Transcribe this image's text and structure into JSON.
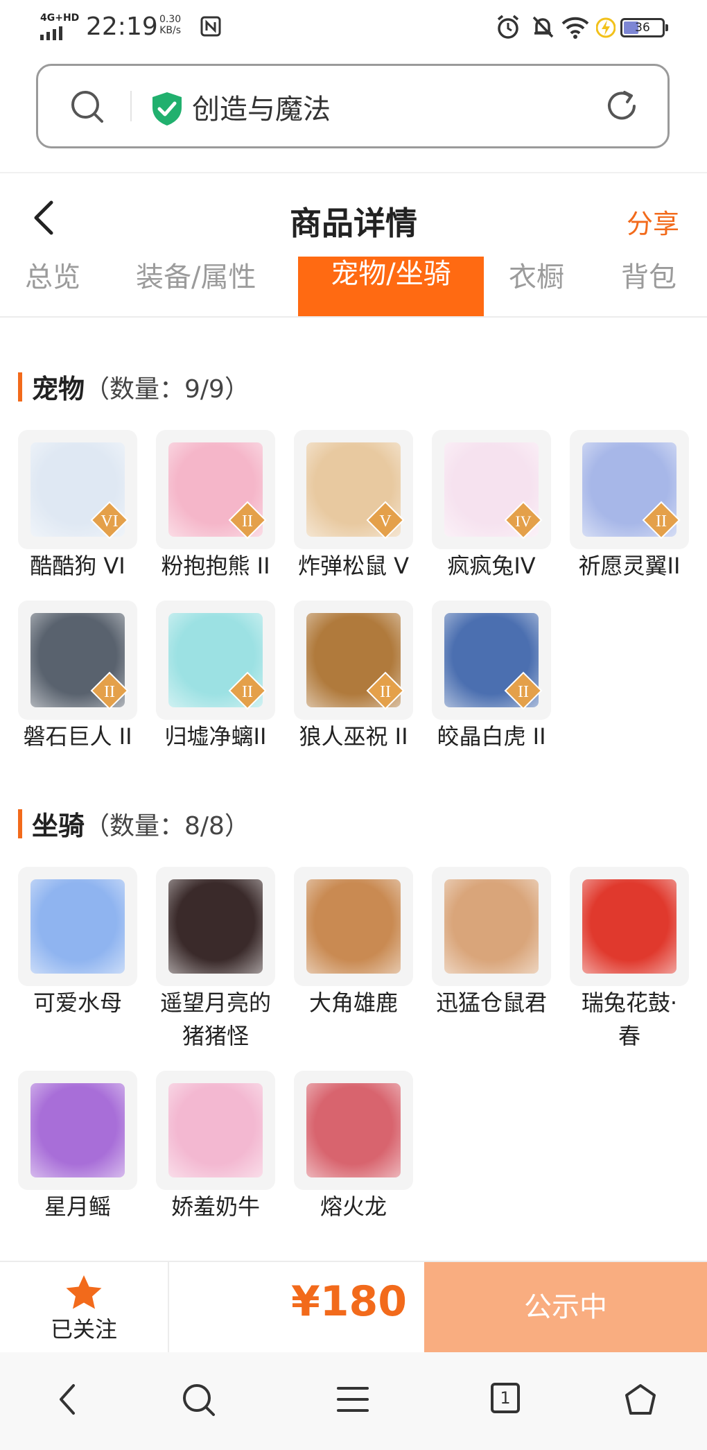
{
  "status_bar": {
    "network": "4G+HD",
    "time": "22:19",
    "speed_value": "0.30",
    "speed_unit": "KB/s",
    "battery": "36",
    "icons": [
      "signal-icon",
      "nfc-icon",
      "alarm-icon",
      "mute-icon",
      "wifi-icon",
      "charging-icon",
      "battery-icon"
    ]
  },
  "address_bar": {
    "site_title": "创造与魔法",
    "icons": [
      "search-icon",
      "verified-shield-icon",
      "reload-icon"
    ]
  },
  "header": {
    "title": "商品详情",
    "share_label": "分享"
  },
  "tabs": [
    {
      "label": "总览",
      "active": false
    },
    {
      "label": "装备/属性",
      "active": false
    },
    {
      "label": "宠物/坐骑",
      "active": true
    },
    {
      "label": "衣橱",
      "active": false
    },
    {
      "label": "背包",
      "active": false
    }
  ],
  "pets": {
    "title": "宠物",
    "count": "（数量：9/9）",
    "items": [
      {
        "name": "酷酷狗 VI",
        "tier": "VI",
        "color": "#dfe8f3"
      },
      {
        "name": "粉抱抱熊 II",
        "tier": "II",
        "color": "#f5b6c9"
      },
      {
        "name": "炸弹松鼠 V",
        "tier": "V",
        "color": "#e8c9a0"
      },
      {
        "name": "疯疯兔IV",
        "tier": "IV",
        "color": "#f6e2ef"
      },
      {
        "name": "祈愿灵翼II",
        "tier": "II",
        "color": "#a7b7e8"
      },
      {
        "name": "磐石巨人 II",
        "tier": "II",
        "color": "#59626e"
      },
      {
        "name": "归墟净螭II",
        "tier": "II",
        "color": "#9ce1e3"
      },
      {
        "name": "狼人巫祝 II",
        "tier": "II",
        "color": "#b07a3c"
      },
      {
        "name": "皎晶白虎 II",
        "tier": "II",
        "color": "#4b6fb0"
      }
    ]
  },
  "mounts": {
    "title": "坐骑",
    "count": "（数量：8/8）",
    "items": [
      {
        "name": "可爱水母",
        "color": "#8fb4f0"
      },
      {
        "name": "遥望月亮的猪猪怪",
        "color": "#3a2a2a"
      },
      {
        "name": "大角雄鹿",
        "color": "#c98a52"
      },
      {
        "name": "迅猛仓鼠君",
        "color": "#d9a57a"
      },
      {
        "name": "瑞兔花鼓·春",
        "color": "#e0392d"
      },
      {
        "name": "星月鳐",
        "color": "#a86ed8"
      },
      {
        "name": "娇羞奶牛",
        "color": "#f3b8d1"
      },
      {
        "name": "熔火龙",
        "color": "#d8646e"
      }
    ]
  },
  "bottom_bar": {
    "follow_label": "已关注",
    "price": "¥180",
    "status_button": "公示中"
  },
  "browser_nav": {
    "tab_count": "1",
    "icons": [
      "back-icon",
      "search-icon",
      "menu-icon",
      "tabs-icon",
      "home-icon"
    ]
  },
  "colors": {
    "accent": "#f26a1b",
    "active_tab": "#ff6a12",
    "status_button_bg": "#f9ad80",
    "badge": "#e4a04a"
  }
}
